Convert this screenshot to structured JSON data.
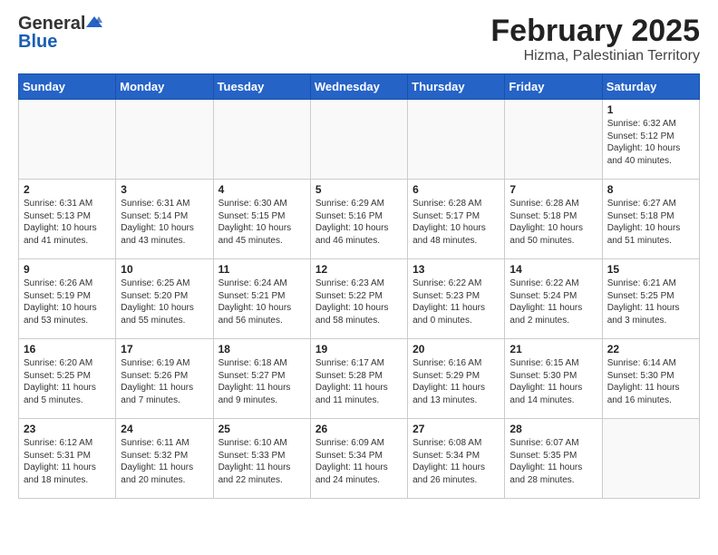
{
  "header": {
    "logo_general": "General",
    "logo_blue": "Blue",
    "month": "February 2025",
    "location": "Hizma, Palestinian Territory"
  },
  "weekdays": [
    "Sunday",
    "Monday",
    "Tuesday",
    "Wednesday",
    "Thursday",
    "Friday",
    "Saturday"
  ],
  "weeks": [
    [
      {
        "day": "",
        "info": ""
      },
      {
        "day": "",
        "info": ""
      },
      {
        "day": "",
        "info": ""
      },
      {
        "day": "",
        "info": ""
      },
      {
        "day": "",
        "info": ""
      },
      {
        "day": "",
        "info": ""
      },
      {
        "day": "1",
        "info": "Sunrise: 6:32 AM\nSunset: 5:12 PM\nDaylight: 10 hours and 40 minutes."
      }
    ],
    [
      {
        "day": "2",
        "info": "Sunrise: 6:31 AM\nSunset: 5:13 PM\nDaylight: 10 hours and 41 minutes."
      },
      {
        "day": "3",
        "info": "Sunrise: 6:31 AM\nSunset: 5:14 PM\nDaylight: 10 hours and 43 minutes."
      },
      {
        "day": "4",
        "info": "Sunrise: 6:30 AM\nSunset: 5:15 PM\nDaylight: 10 hours and 45 minutes."
      },
      {
        "day": "5",
        "info": "Sunrise: 6:29 AM\nSunset: 5:16 PM\nDaylight: 10 hours and 46 minutes."
      },
      {
        "day": "6",
        "info": "Sunrise: 6:28 AM\nSunset: 5:17 PM\nDaylight: 10 hours and 48 minutes."
      },
      {
        "day": "7",
        "info": "Sunrise: 6:28 AM\nSunset: 5:18 PM\nDaylight: 10 hours and 50 minutes."
      },
      {
        "day": "8",
        "info": "Sunrise: 6:27 AM\nSunset: 5:18 PM\nDaylight: 10 hours and 51 minutes."
      }
    ],
    [
      {
        "day": "9",
        "info": "Sunrise: 6:26 AM\nSunset: 5:19 PM\nDaylight: 10 hours and 53 minutes."
      },
      {
        "day": "10",
        "info": "Sunrise: 6:25 AM\nSunset: 5:20 PM\nDaylight: 10 hours and 55 minutes."
      },
      {
        "day": "11",
        "info": "Sunrise: 6:24 AM\nSunset: 5:21 PM\nDaylight: 10 hours and 56 minutes."
      },
      {
        "day": "12",
        "info": "Sunrise: 6:23 AM\nSunset: 5:22 PM\nDaylight: 10 hours and 58 minutes."
      },
      {
        "day": "13",
        "info": "Sunrise: 6:22 AM\nSunset: 5:23 PM\nDaylight: 11 hours and 0 minutes."
      },
      {
        "day": "14",
        "info": "Sunrise: 6:22 AM\nSunset: 5:24 PM\nDaylight: 11 hours and 2 minutes."
      },
      {
        "day": "15",
        "info": "Sunrise: 6:21 AM\nSunset: 5:25 PM\nDaylight: 11 hours and 3 minutes."
      }
    ],
    [
      {
        "day": "16",
        "info": "Sunrise: 6:20 AM\nSunset: 5:25 PM\nDaylight: 11 hours and 5 minutes."
      },
      {
        "day": "17",
        "info": "Sunrise: 6:19 AM\nSunset: 5:26 PM\nDaylight: 11 hours and 7 minutes."
      },
      {
        "day": "18",
        "info": "Sunrise: 6:18 AM\nSunset: 5:27 PM\nDaylight: 11 hours and 9 minutes."
      },
      {
        "day": "19",
        "info": "Sunrise: 6:17 AM\nSunset: 5:28 PM\nDaylight: 11 hours and 11 minutes."
      },
      {
        "day": "20",
        "info": "Sunrise: 6:16 AM\nSunset: 5:29 PM\nDaylight: 11 hours and 13 minutes."
      },
      {
        "day": "21",
        "info": "Sunrise: 6:15 AM\nSunset: 5:30 PM\nDaylight: 11 hours and 14 minutes."
      },
      {
        "day": "22",
        "info": "Sunrise: 6:14 AM\nSunset: 5:30 PM\nDaylight: 11 hours and 16 minutes."
      }
    ],
    [
      {
        "day": "23",
        "info": "Sunrise: 6:12 AM\nSunset: 5:31 PM\nDaylight: 11 hours and 18 minutes."
      },
      {
        "day": "24",
        "info": "Sunrise: 6:11 AM\nSunset: 5:32 PM\nDaylight: 11 hours and 20 minutes."
      },
      {
        "day": "25",
        "info": "Sunrise: 6:10 AM\nSunset: 5:33 PM\nDaylight: 11 hours and 22 minutes."
      },
      {
        "day": "26",
        "info": "Sunrise: 6:09 AM\nSunset: 5:34 PM\nDaylight: 11 hours and 24 minutes."
      },
      {
        "day": "27",
        "info": "Sunrise: 6:08 AM\nSunset: 5:34 PM\nDaylight: 11 hours and 26 minutes."
      },
      {
        "day": "28",
        "info": "Sunrise: 6:07 AM\nSunset: 5:35 PM\nDaylight: 11 hours and 28 minutes."
      },
      {
        "day": "",
        "info": ""
      }
    ]
  ]
}
